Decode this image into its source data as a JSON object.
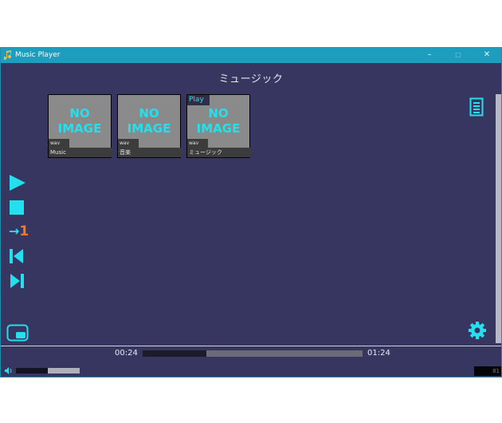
{
  "window": {
    "title": "Music Player",
    "controls": {
      "minimize": "–",
      "maximize": "□",
      "close": "✕"
    }
  },
  "now_playing_title": "ミュージック",
  "tracks": [
    {
      "cover_text": [
        "NO",
        "IMAGE"
      ],
      "format": "wav",
      "name": "Music",
      "playing": false
    },
    {
      "cover_text": [
        "NO",
        "IMAGE"
      ],
      "format": "wav",
      "name": "音楽",
      "playing": false
    },
    {
      "cover_text": [
        "NO",
        "IMAGE"
      ],
      "format": "wav",
      "name": "ミュージック",
      "playing": true,
      "tag": "Play"
    }
  ],
  "controls": {
    "repeat_mode_label": "→",
    "repeat_mode_value": "1"
  },
  "playback": {
    "elapsed": "00:24",
    "total": "01:24",
    "progress_fraction": 0.29
  },
  "volume": {
    "level_fraction": 0.5
  },
  "mini_indicator": "81",
  "colors": {
    "window_bg": "#363660",
    "titlebar": "#1e9dbf",
    "accent_cyan": "#24e0ef",
    "accent_orange": "#f07a2a"
  }
}
